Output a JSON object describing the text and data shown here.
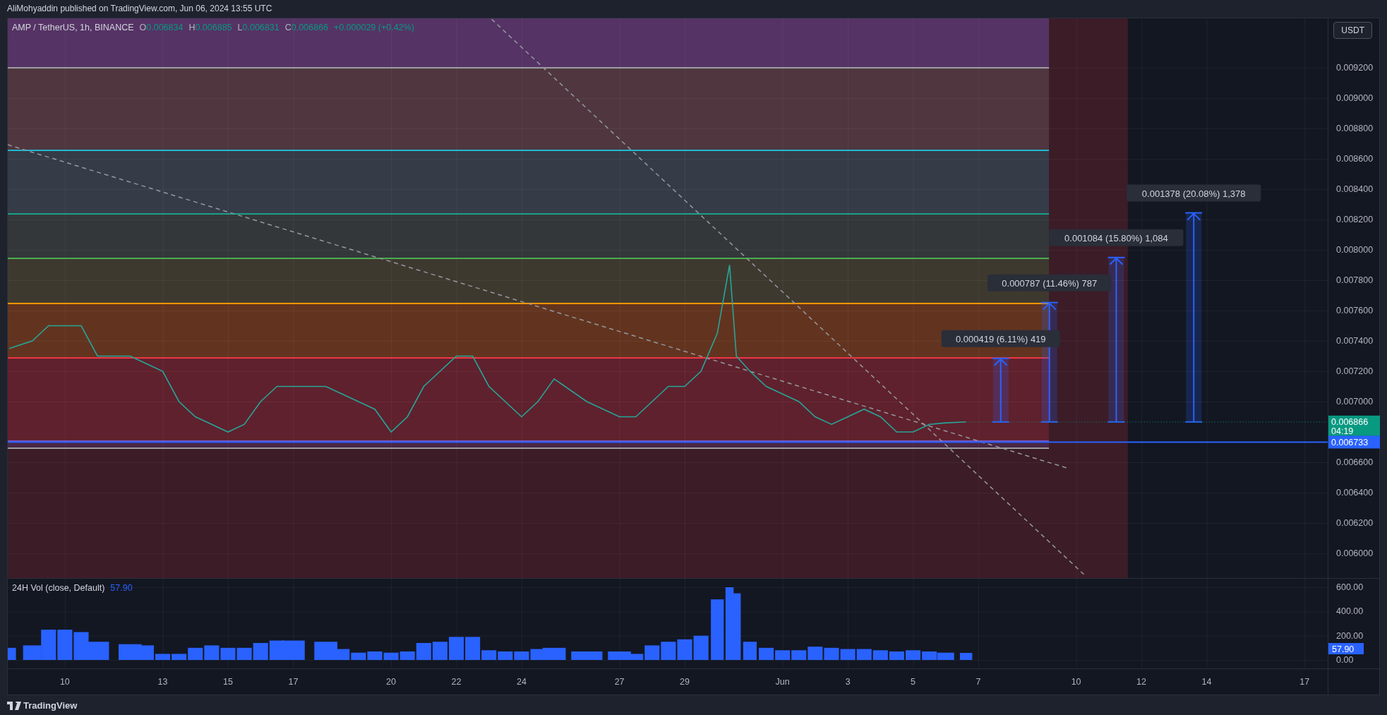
{
  "publish_line": "AliMohyaddin published on TradingView.com, Jun 06, 2024 13:55 UTC",
  "legend": {
    "symbol": "AMP / TetherUS, 1h, BINANCE",
    "ohlc": [
      {
        "key": "O",
        "value": "0.006834"
      },
      {
        "key": "H",
        "value": "0.006885"
      },
      {
        "key": "L",
        "value": "0.006831"
      },
      {
        "key": "C",
        "value": "0.006866"
      }
    ],
    "change": "+0.000029 (+0.42%)"
  },
  "currency_button": "USDT",
  "main_chart": {
    "last_price_tag": "0.006866",
    "countdown": "04:19",
    "price_line_tag": "0.006733",
    "chart_data": {
      "type": "line",
      "xlim": [
        "2024-05-08T06:00",
        "2024-06-19T08:00"
      ],
      "ylim": [
        0.005837,
        0.009526
      ],
      "x": [
        "2024-05-08T07:00",
        "2024-05-09T00:00",
        "2024-05-09T12:00",
        "2024-05-10T00:00",
        "2024-05-10T12:00",
        "2024-05-11T00:00",
        "2024-05-12T00:00",
        "2024-05-12T12:00",
        "2024-05-13T00:00",
        "2024-05-13T12:00",
        "2024-05-14T00:00",
        "2024-05-14T12:00",
        "2024-05-15T00:00",
        "2024-05-15T12:00",
        "2024-05-16T00:00",
        "2024-05-16T12:00",
        "2024-05-17T00:00",
        "2024-05-18T00:00",
        "2024-05-18T12:00",
        "2024-05-19T00:00",
        "2024-05-19T12:00",
        "2024-05-20T00:00",
        "2024-05-20T12:00",
        "2024-05-21T00:00",
        "2024-05-21T12:00",
        "2024-05-22T00:00",
        "2024-05-22T12:00",
        "2024-05-23T00:00",
        "2024-05-23T12:00",
        "2024-05-24T00:00",
        "2024-05-24T12:00",
        "2024-05-25T00:00",
        "2024-05-26T00:00",
        "2024-05-27T00:00",
        "2024-05-27T12:00",
        "2024-05-28T00:00",
        "2024-05-28T12:00",
        "2024-05-29T00:00",
        "2024-05-29T12:00",
        "2024-05-30T00:00",
        "2024-05-30T09:00",
        "2024-05-30T14:00",
        "2024-05-31T00:00",
        "2024-05-31T12:00",
        "2024-06-01T00:00",
        "2024-06-01T12:00",
        "2024-06-02T00:00",
        "2024-06-02T12:00",
        "2024-06-03T00:00",
        "2024-06-03T12:00",
        "2024-06-04T00:00",
        "2024-06-04T12:00",
        "2024-06-05T00:00",
        "2024-06-05T12:00",
        "2024-06-06T00:00",
        "2024-06-06T15:00"
      ],
      "series": [
        {
          "color": "#26a69a",
          "values": [
            0.00735,
            0.0074,
            0.0075,
            0.0075,
            0.0075,
            0.0073,
            0.0073,
            0.00725,
            0.0072,
            0.007,
            0.0069,
            0.00685,
            0.0068,
            0.00685,
            0.007,
            0.0071,
            0.0071,
            0.0071,
            0.00705,
            0.007,
            0.00695,
            0.0068,
            0.0069,
            0.0071,
            0.0072,
            0.0073,
            0.0073,
            0.0071,
            0.007,
            0.0069,
            0.007,
            0.00715,
            0.007,
            0.0069,
            0.0069,
            0.007,
            0.0071,
            0.0071,
            0.0072,
            0.00745,
            0.0079,
            0.0073,
            0.0072,
            0.0071,
            0.00705,
            0.007,
            0.0069,
            0.00685,
            0.0069,
            0.00695,
            0.0069,
            0.0068,
            0.0068,
            0.00685,
            0.00686,
            0.006866
          ]
        }
      ],
      "yticks": [
        {
          "value": 0.006,
          "label": "0.006000"
        },
        {
          "value": 0.0062,
          "label": "0.006200"
        },
        {
          "value": 0.0064,
          "label": "0.006400"
        },
        {
          "value": 0.0066,
          "label": "0.006600"
        },
        {
          "value": 0.007,
          "label": "0.007000"
        },
        {
          "value": 0.0072,
          "label": "0.007200"
        },
        {
          "value": 0.0074,
          "label": "0.007400"
        },
        {
          "value": 0.0076,
          "label": "0.007600"
        },
        {
          "value": 0.0078,
          "label": "0.007800"
        },
        {
          "value": 0.008,
          "label": "0.008000"
        },
        {
          "value": 0.0082,
          "label": "0.008200"
        },
        {
          "value": 0.0084,
          "label": "0.008400"
        },
        {
          "value": 0.0086,
          "label": "0.008600"
        },
        {
          "value": 0.0088,
          "label": "0.008800"
        },
        {
          "value": 0.009,
          "label": "0.009000"
        },
        {
          "value": 0.0092,
          "label": "0.009200"
        }
      ],
      "annotations": [
        "0.000419 (6.11%) 419",
        "0.000787 (11.46%) 787",
        "0.001084 (15.80%) 1,084",
        "0.001378 (20.08%) 1,378"
      ]
    }
  },
  "volume_chart": {
    "legend": {
      "name": "24H Vol (close, Default)",
      "value": "57.90"
    },
    "last_value_tag": "57.90",
    "chart_data": {
      "type": "bar",
      "xlim": [
        "2024-05-08T06:00",
        "2024-06-19T08:00"
      ],
      "ylim": [
        -70,
        670
      ],
      "xticks": [
        {
          "value": "2024-05-10T00:00",
          "label": "10"
        },
        {
          "value": "2024-05-13T00:00",
          "label": "13"
        },
        {
          "value": "2024-05-15T00:00",
          "label": "15"
        },
        {
          "value": "2024-05-17T00:00",
          "label": "17"
        },
        {
          "value": "2024-05-20T00:00",
          "label": "20"
        },
        {
          "value": "2024-05-22T00:00",
          "label": "22"
        },
        {
          "value": "2024-05-24T00:00",
          "label": "24"
        },
        {
          "value": "2024-05-27T00:00",
          "label": "27"
        },
        {
          "value": "2024-05-29T00:00",
          "label": "29"
        },
        {
          "value": "2024-06-01T00:00",
          "label": "Jun"
        },
        {
          "value": "2024-06-03T00:00",
          "label": "3"
        },
        {
          "value": "2024-06-05T00:00",
          "label": "5"
        },
        {
          "value": "2024-06-07T00:00",
          "label": "7"
        },
        {
          "value": "2024-06-10T00:00",
          "label": "10"
        },
        {
          "value": "2024-06-12T00:00",
          "label": "12"
        },
        {
          "value": "2024-06-14T00:00",
          "label": "14"
        },
        {
          "value": "2024-06-17T00:00",
          "label": "17"
        }
      ],
      "x": [
        "2024-05-08T07:00",
        "2024-05-09T00:00",
        "2024-05-09T12:00",
        "2024-05-10T00:00",
        "2024-05-10T12:00",
        "2024-05-11T00:00",
        "2024-05-12T00:00",
        "2024-05-12T12:00",
        "2024-05-13T00:00",
        "2024-05-13T12:00",
        "2024-05-14T00:00",
        "2024-05-14T12:00",
        "2024-05-15T00:00",
        "2024-05-15T12:00",
        "2024-05-16T00:00",
        "2024-05-16T12:00",
        "2024-05-17T00:00",
        "2024-05-18T00:00",
        "2024-05-18T12:00",
        "2024-05-19T00:00",
        "2024-05-19T12:00",
        "2024-05-20T00:00",
        "2024-05-20T12:00",
        "2024-05-21T00:00",
        "2024-05-21T12:00",
        "2024-05-22T00:00",
        "2024-05-22T12:00",
        "2024-05-23T00:00",
        "2024-05-23T12:00",
        "2024-05-24T00:00",
        "2024-05-24T12:00",
        "2024-05-25T00:00",
        "2024-05-26T00:00",
        "2024-05-27T00:00",
        "2024-05-27T12:00",
        "2024-05-28T00:00",
        "2024-05-28T12:00",
        "2024-05-29T00:00",
        "2024-05-29T12:00",
        "2024-05-30T00:00",
        "2024-05-30T09:00",
        "2024-05-30T14:00",
        "2024-05-31T00:00",
        "2024-05-31T12:00",
        "2024-06-01T00:00",
        "2024-06-01T12:00",
        "2024-06-02T00:00",
        "2024-06-02T12:00",
        "2024-06-03T00:00",
        "2024-06-03T12:00",
        "2024-06-04T00:00",
        "2024-06-04T12:00",
        "2024-06-05T00:00",
        "2024-06-05T12:00",
        "2024-06-06T00:00",
        "2024-06-06T15:00"
      ],
      "series": [
        {
          "color": "#2962ff",
          "values": [
            100,
            120,
            250,
            250,
            230,
            150,
            130,
            120,
            50,
            50,
            100,
            120,
            100,
            100,
            140,
            160,
            160,
            150,
            90,
            60,
            70,
            60,
            70,
            140,
            150,
            190,
            190,
            80,
            70,
            70,
            90,
            100,
            70,
            70,
            50,
            120,
            150,
            170,
            200,
            500,
            600,
            550,
            150,
            100,
            80,
            80,
            110,
            100,
            90,
            90,
            80,
            70,
            80,
            70,
            60,
            58
          ]
        }
      ],
      "yticks": [
        {
          "value": 0,
          "label": "0.00"
        },
        {
          "value": 200,
          "label": "200.00"
        },
        {
          "value": 400,
          "label": "400.00"
        },
        {
          "value": 600,
          "label": "600.00"
        }
      ]
    }
  },
  "brand": "TradingView"
}
